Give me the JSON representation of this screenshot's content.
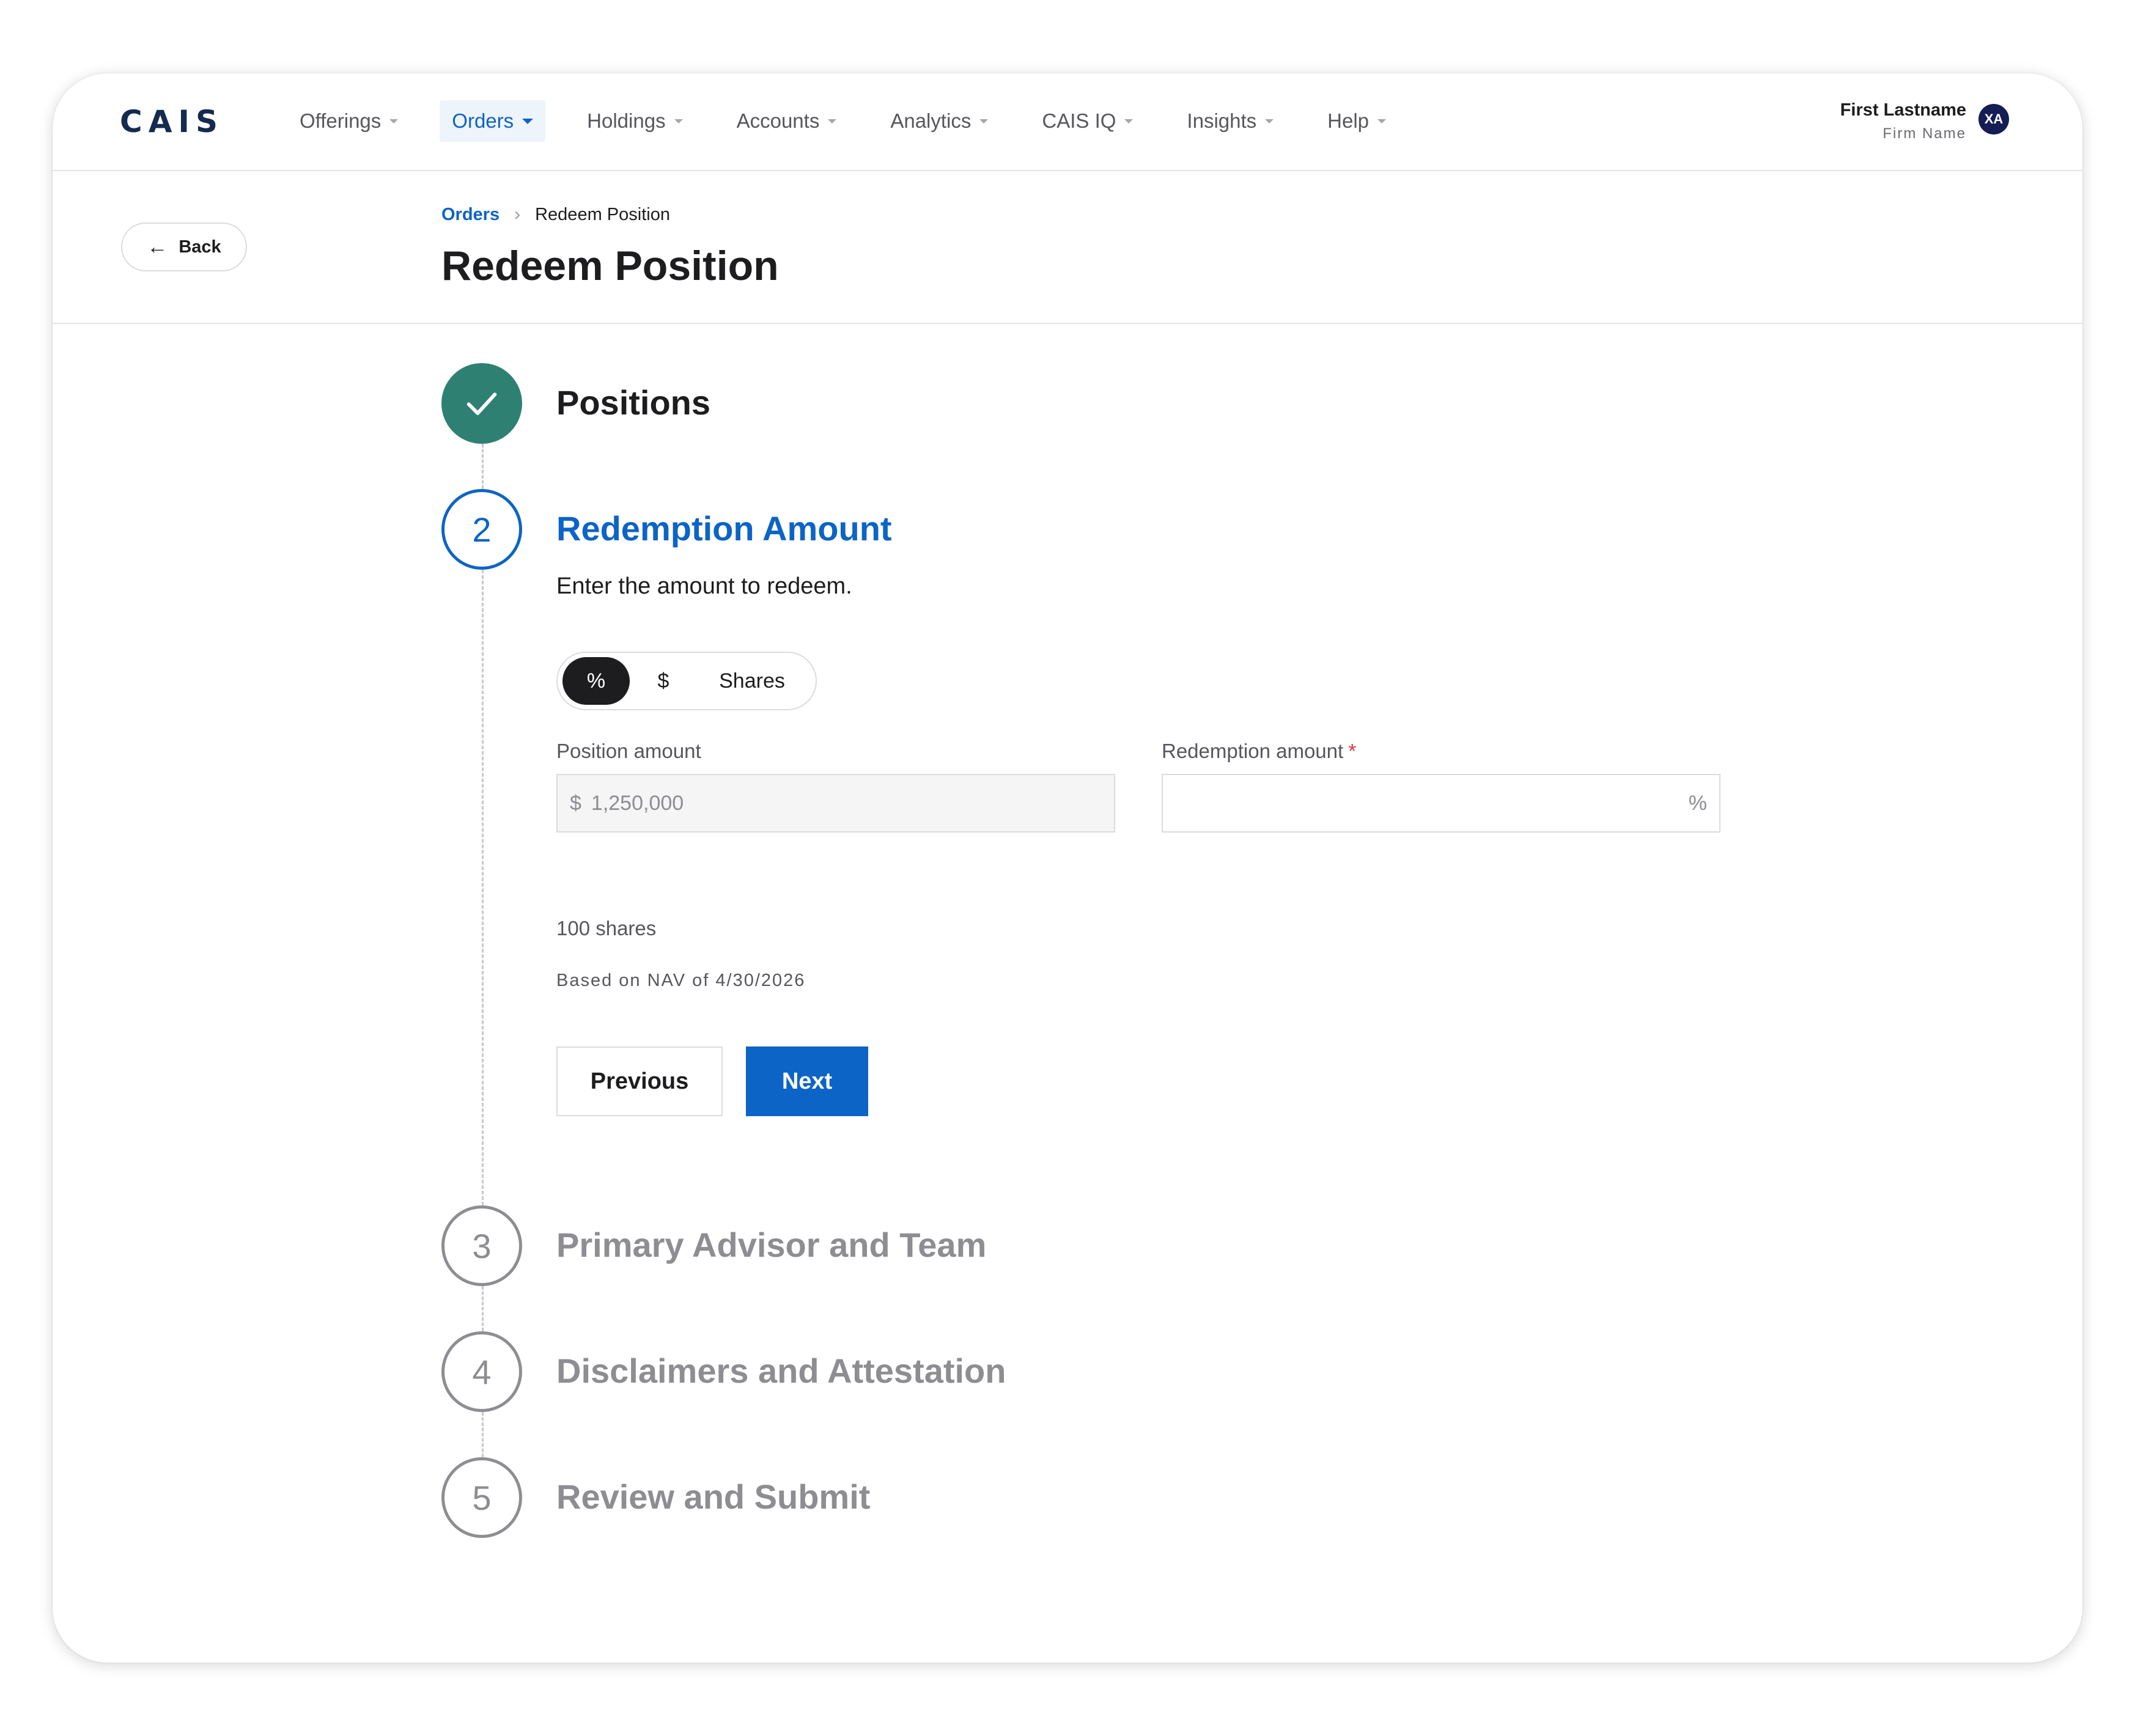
{
  "brand": {
    "logo": "CAIS"
  },
  "nav": {
    "items": [
      {
        "label": "Offerings",
        "active": false
      },
      {
        "label": "Orders",
        "active": true
      },
      {
        "label": "Holdings",
        "active": false
      },
      {
        "label": "Accounts",
        "active": false
      },
      {
        "label": "Analytics",
        "active": false
      },
      {
        "label": "CAIS IQ",
        "active": false
      },
      {
        "label": "Insights",
        "active": false
      },
      {
        "label": "Help",
        "active": false
      }
    ]
  },
  "user": {
    "name": "First Lastname",
    "firm": "Firm Name",
    "initials": "XA"
  },
  "header": {
    "back_label": "Back",
    "breadcrumb": {
      "parent": "Orders",
      "current": "Redeem Position"
    },
    "title": "Redeem Position"
  },
  "steps": [
    {
      "number": "1",
      "title": "Positions",
      "state": "done"
    },
    {
      "number": "2",
      "title": "Redemption Amount",
      "state": "active"
    },
    {
      "number": "3",
      "title": "Primary Advisor and Team",
      "state": "pending"
    },
    {
      "number": "4",
      "title": "Disclaimers and Attestation",
      "state": "pending"
    },
    {
      "number": "5",
      "title": "Review and Submit",
      "state": "pending"
    }
  ],
  "redemption": {
    "instructions": "Enter the amount to redeem.",
    "unit_toggle": {
      "options": [
        "%",
        "$",
        "Shares"
      ],
      "selected": "%"
    },
    "position_amount": {
      "label": "Position amount",
      "prefix": "$",
      "value": "1,250,000"
    },
    "redemption_amount": {
      "label": "Redemption amount",
      "required_mark": "*",
      "value": "",
      "suffix": "%"
    },
    "shares_note": "100 shares",
    "nav_note": "Based on NAV of 4/30/2026"
  },
  "actions": {
    "previous_label": "Previous",
    "next_label": "Next"
  },
  "colors": {
    "accent": "#0c64c6",
    "step_done": "#2e8172",
    "step_pending": "#8d8d92",
    "brand_navy": "#142a4f",
    "avatar": "#141d54",
    "required": "#d43c3c"
  }
}
